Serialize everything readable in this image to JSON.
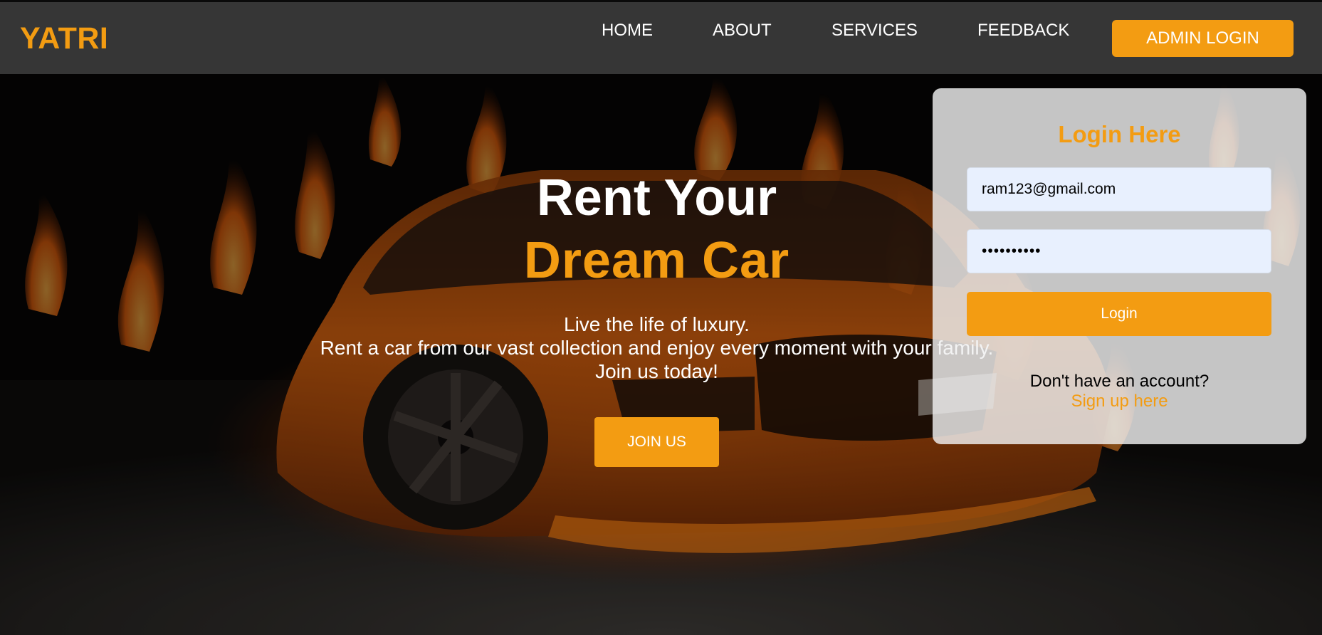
{
  "brand": {
    "name": "YATRI",
    "accent_color": "#f39c12",
    "navbar_color": "#363636"
  },
  "nav": {
    "links": [
      "HOME",
      "ABOUT",
      "SERVICES",
      "FEEDBACK"
    ],
    "admin_button": "ADMIN LOGIN"
  },
  "hero": {
    "background": "flaming-orange-sports-car-image",
    "heading_line1": "Rent Your",
    "heading_line2": "Dream Car",
    "subtext": [
      "Live the life of luxury.",
      "Rent a car from our vast collection and enjoy every moment with your family.",
      "Join us today!"
    ],
    "cta_button": "JOIN US"
  },
  "login": {
    "title": "Login Here",
    "email_value": "ram123@gmail.com",
    "password_value": "••••••••••",
    "submit_label": "Login",
    "no_account_text": "Don't have an account?",
    "signup_link": "Sign up here"
  }
}
